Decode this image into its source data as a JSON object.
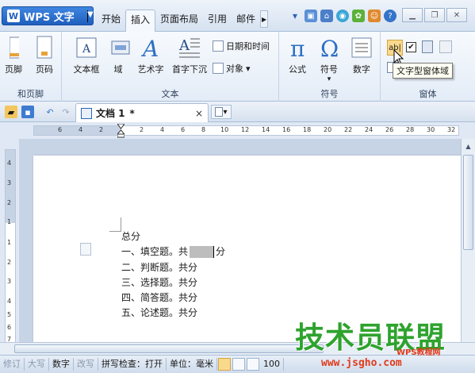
{
  "app": {
    "menu_label": "WPS 文字",
    "logo_letter": "W"
  },
  "menu_tabs": [
    "开始",
    "插入",
    "页面布局",
    "引用",
    "邮件"
  ],
  "active_tab": "插入",
  "ribbon": {
    "header_footer": {
      "left_label": "页脚",
      "page_number": "页码",
      "group": "和页脚"
    },
    "text_group": {
      "textbox": "文本框",
      "field": "域",
      "wordart": "艺术字",
      "dropcap": "首字下沉",
      "datetime": "日期和时间",
      "object": "对象",
      "group": "文本"
    },
    "symbol_group": {
      "formula": "公式",
      "symbol": "符号",
      "number": "数字",
      "group": "符号"
    },
    "form_group": {
      "text_field_label": "ab|",
      "group": "窗体"
    }
  },
  "tooltip": "文字型窗体域",
  "doc_tab": {
    "title": "文档 1",
    "modified": "*",
    "close": "×"
  },
  "ruler": {
    "h_ticks": [
      "6",
      "4",
      "2",
      "2",
      "4",
      "6",
      "8",
      "10",
      "12",
      "14",
      "16",
      "18",
      "20",
      "22",
      "24",
      "26",
      "28",
      "30",
      "32"
    ],
    "v_ticks": [
      "4",
      "3",
      "2",
      "1",
      "1",
      "2",
      "3",
      "4",
      "5",
      "6",
      "7"
    ]
  },
  "document": {
    "heading": "总分",
    "lines": [
      {
        "prefix": "一、填空题。共",
        "suffix": "分",
        "has_field": true
      },
      {
        "prefix": "二、判断题。共分",
        "suffix": "",
        "has_field": false
      },
      {
        "prefix": "三、选择题。共分",
        "suffix": "",
        "has_field": false
      },
      {
        "prefix": "四、简答题。共分",
        "suffix": "",
        "has_field": false
      },
      {
        "prefix": "五、论述题。共分",
        "suffix": "",
        "has_field": false
      }
    ]
  },
  "status": {
    "overwrite": "修订",
    "caps": "大写",
    "numlock": "数字",
    "overtype": "改写",
    "spellcheck": "拼写检查：打开",
    "unit": "单位：毫米",
    "zoom": "100"
  },
  "watermark": {
    "text": "技术员联盟",
    "url": "www.jsgho.com",
    "small": "WPS教程网"
  },
  "colors": {
    "app_button": "#1f5fbf",
    "watermark_green": "#2ea32e",
    "watermark_red": "#e03a1c"
  }
}
